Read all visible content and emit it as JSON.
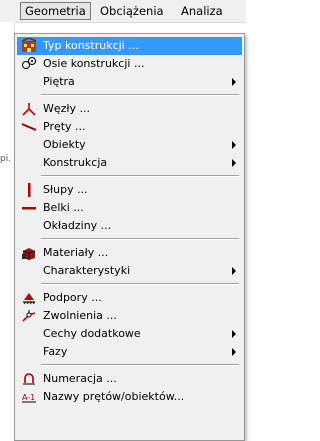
{
  "menubar": {
    "items": [
      {
        "label": "Geometria"
      },
      {
        "label": "Obciążenia"
      },
      {
        "label": "Analiza"
      }
    ]
  },
  "background": {
    "fragment_text": "pi."
  },
  "dropdown": {
    "groups": [
      [
        {
          "label": "Typ konstrukcji ...",
          "icon": "structure-type-icon",
          "highlighted": true
        },
        {
          "label": "Osie konstrukcji ...",
          "icon": "axes-icon"
        },
        {
          "label": "Piętra",
          "submenu": true
        }
      ],
      [
        {
          "label": "Węzły ...",
          "icon": "nodes-icon"
        },
        {
          "label": "Pręty ...",
          "icon": "bars-icon"
        },
        {
          "label": "Obiekty",
          "submenu": true
        },
        {
          "label": "Konstrukcja",
          "submenu": true
        }
      ],
      [
        {
          "label": "Słupy ...",
          "icon": "column-icon"
        },
        {
          "label": "Belki ...",
          "icon": "beam-icon"
        },
        {
          "label": "Okładziny ..."
        }
      ],
      [
        {
          "label": "Materiały ...",
          "icon": "materials-icon"
        },
        {
          "label": "Charakterystyki",
          "submenu": true
        }
      ],
      [
        {
          "label": "Podpory ...",
          "icon": "supports-icon"
        },
        {
          "label": "Zwolnienia ...",
          "icon": "releases-icon"
        },
        {
          "label": "Cechy dodatkowe",
          "submenu": true
        },
        {
          "label": "Fazy",
          "submenu": true
        }
      ],
      [
        {
          "label": "Numeracja ...",
          "icon": "numbering-icon"
        },
        {
          "label": "Nazwy prętów/obiektów...",
          "icon": "names-icon"
        }
      ]
    ]
  }
}
